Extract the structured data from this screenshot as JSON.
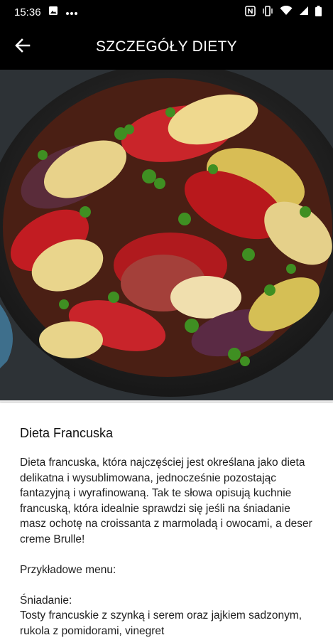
{
  "status_bar": {
    "time": "15:36",
    "left_icons": [
      "image-icon",
      "more-dots-icon"
    ],
    "right_icons": [
      "nfc-icon",
      "vibrate-icon",
      "wifi-icon",
      "signal-icon",
      "battery-icon"
    ]
  },
  "app_bar": {
    "back_icon": "arrow-left-icon",
    "title": "SZCZEGÓŁY DIETY"
  },
  "hero_image": {
    "subject": "ratatouille-in-skillet"
  },
  "article": {
    "title": "Dieta Francuska",
    "intro": "Dieta francuska, która najczęściej jest określana jako dieta delikatna i wysublimowana, jednocześnie pozostając fantazyjną i wyrafinowaną. Tak te słowa opisują kuchnie francuską, która idealnie sprawdzi się jeśli na śniadanie masz ochotę na croissanta z marmoladą i owocami, a deser creme Brulle!",
    "menu_heading": "Przykładowe menu:",
    "breakfast_label": "Śniadanie:",
    "breakfast_text": "Tosty francuskie z szynką i serem oraz jajkiem sadzonym, rukola z pomidorami, vinegret"
  },
  "colors": {
    "bar": "#000000",
    "background": "#ececec",
    "card": "#ffffff",
    "text": "#1e1e1e"
  }
}
